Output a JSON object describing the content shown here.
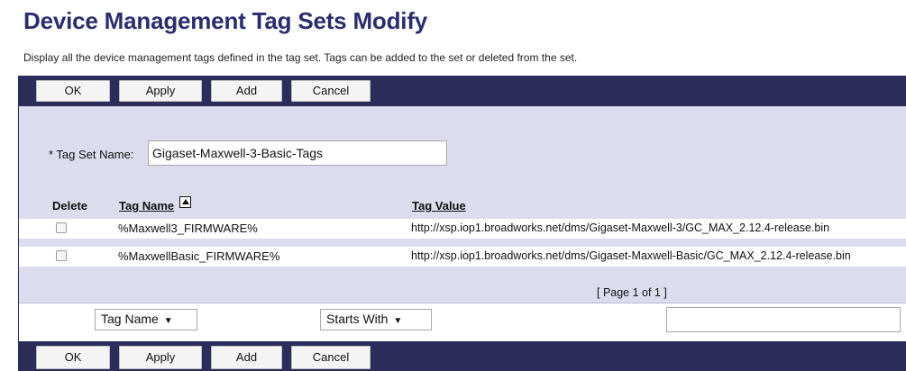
{
  "header": {
    "title": "Device Management Tag Sets Modify",
    "description": "Display all the device management tags defined in the tag set. Tags can be added to the set or deleted from the set."
  },
  "toolbar": {
    "ok_label": "OK",
    "apply_label": "Apply",
    "add_label": "Add",
    "cancel_label": "Cancel"
  },
  "form": {
    "tag_set_name_label": "* Tag Set Name:",
    "tag_set_name_value": "Gigaset-Maxwell-3-Basic-Tags"
  },
  "table": {
    "columns": {
      "delete": "Delete",
      "tag_name": "Tag Name",
      "tag_value": "Tag Value"
    },
    "rows": [
      {
        "tag_name": "%Maxwell3_FIRMWARE%",
        "tag_value": "http://xsp.iop1.broadworks.net/dms/Gigaset-Maxwell-3/GC_MAX_2.12.4-release.bin",
        "delete_checked": false
      },
      {
        "tag_name": "%MaxwellBasic_FIRMWARE%",
        "tag_value": "http://xsp.iop1.broadworks.net/dms/Gigaset-Maxwell-Basic/GC_MAX_2.12.4-release.bin",
        "delete_checked": false
      }
    ],
    "pagination": "[ Page 1 of 1 ]",
    "sort_icon": "sort-ascending-icon"
  },
  "search": {
    "field_selected": "Tag Name",
    "mode_selected": "Starts With",
    "query_value": ""
  },
  "colors": {
    "title": "#2b2d6e",
    "toolbar_bg": "#2d2d5c",
    "panel_bg": "#dcdcee"
  }
}
